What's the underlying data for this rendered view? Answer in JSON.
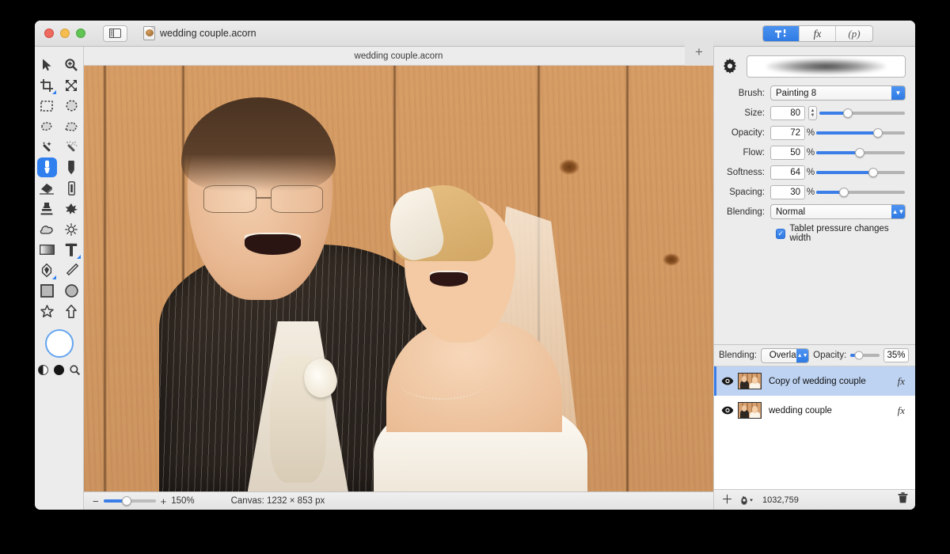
{
  "window": {
    "traffic_lights": [
      "close",
      "minimize",
      "zoom"
    ],
    "sidebar_toggle_icon": "sidebar-icon",
    "document_title": "wedding couple.acorn",
    "document_icon": "acorn-document-icon"
  },
  "titlebar_segments": [
    {
      "name": "tools-segment",
      "icon": "hammer-tool-icon",
      "label": "",
      "active": true
    },
    {
      "name": "filters-segment",
      "icon": "fx-icon",
      "label": "fx",
      "active": false
    },
    {
      "name": "palette-segment",
      "icon": "p-icon",
      "label": "(p)",
      "active": false
    }
  ],
  "tools": [
    {
      "name": "move-tool",
      "icon": "arrow-cursor-icon",
      "selected": false,
      "submenu": false
    },
    {
      "name": "zoom-tool",
      "icon": "magnifier-plus-icon",
      "selected": false,
      "submenu": false
    },
    {
      "name": "crop-tool",
      "icon": "crop-icon",
      "selected": false,
      "submenu": true
    },
    {
      "name": "transform-tool",
      "icon": "move-arrows-icon",
      "selected": false,
      "submenu": false
    },
    {
      "name": "rectangular-select-tool",
      "icon": "marquee-rect-icon",
      "selected": false,
      "submenu": false
    },
    {
      "name": "elliptical-select-tool",
      "icon": "marquee-ellipse-icon",
      "selected": false,
      "submenu": false
    },
    {
      "name": "lasso-tool",
      "icon": "lasso-icon",
      "selected": false,
      "submenu": false
    },
    {
      "name": "polygon-lasso-tool",
      "icon": "polygon-lasso-icon",
      "selected": false,
      "submenu": false
    },
    {
      "name": "magic-wand-tool",
      "icon": "magic-wand-icon",
      "selected": false,
      "submenu": false
    },
    {
      "name": "instant-alpha-tool",
      "icon": "sparkle-wand-icon",
      "selected": false,
      "submenu": false
    },
    {
      "name": "brush-tool",
      "icon": "paint-brush-icon",
      "selected": true,
      "submenu": false
    },
    {
      "name": "pencil-tool",
      "icon": "pencil-icon",
      "selected": false,
      "submenu": false
    },
    {
      "name": "eraser-tool",
      "icon": "eraser-icon",
      "selected": false,
      "submenu": false
    },
    {
      "name": "smudge-tool",
      "icon": "smudge-icon",
      "selected": false,
      "submenu": false
    },
    {
      "name": "clone-stamp-tool",
      "icon": "clone-stamp-icon",
      "selected": false,
      "submenu": false
    },
    {
      "name": "spatter-tool",
      "icon": "spatter-icon",
      "selected": false,
      "submenu": false
    },
    {
      "name": "blur-tool",
      "icon": "cloud-blur-icon",
      "selected": false,
      "submenu": false
    },
    {
      "name": "dodge-burn-tool",
      "icon": "sun-dodge-icon",
      "selected": false,
      "submenu": false
    },
    {
      "name": "gradient-tool",
      "icon": "gradient-icon",
      "selected": false,
      "submenu": false
    },
    {
      "name": "text-tool",
      "icon": "text-t-icon",
      "selected": false,
      "submenu": true
    },
    {
      "name": "bezier-pen-tool",
      "icon": "pen-nib-icon",
      "selected": false,
      "submenu": true
    },
    {
      "name": "line-tool",
      "icon": "line-icon",
      "selected": false,
      "submenu": false
    },
    {
      "name": "rectangle-shape-tool",
      "icon": "rectangle-icon",
      "selected": false,
      "submenu": false
    },
    {
      "name": "ellipse-shape-tool",
      "icon": "circle-icon",
      "selected": false,
      "submenu": false
    },
    {
      "name": "star-shape-tool",
      "icon": "star-icon",
      "selected": false,
      "submenu": false
    },
    {
      "name": "arrow-shape-tool",
      "icon": "arrow-up-shape-icon",
      "selected": false,
      "submenu": false
    }
  ],
  "color_controls": {
    "foreground_swatch": "#ffffff",
    "half_swatch_icon": "contrast-half-icon",
    "black_swatch_icon": "black-dot-icon",
    "color_picker_icon": "magnifier-picker-icon"
  },
  "canvas": {
    "tab_title": "wedding couple.acorn",
    "add_tab_label": "+",
    "image_description": "wedding couple in front of wooden fence"
  },
  "statusbar": {
    "zoom_minus": "−",
    "zoom_plus": "+",
    "zoom_level": "150%",
    "canvas_size": "Canvas: 1232 × 853 px"
  },
  "inspector": {
    "gear_icon": "gear-icon",
    "brush_preview": "soft-round-brush-stroke-preview",
    "rows": [
      {
        "label": "Brush:",
        "type": "combo",
        "value": "Painting 8",
        "unit": ""
      },
      {
        "label": "Size:",
        "type": "stepper",
        "value": "80",
        "unit": "",
        "slider_pct": 33
      },
      {
        "label": "Opacity:",
        "type": "slider",
        "value": "72",
        "unit": "%",
        "slider_pct": 70
      },
      {
        "label": "Flow:",
        "type": "slider",
        "value": "50",
        "unit": "%",
        "slider_pct": 49
      },
      {
        "label": "Softness:",
        "type": "slider",
        "value": "64",
        "unit": "%",
        "slider_pct": 64
      },
      {
        "label": "Spacing:",
        "type": "slider",
        "value": "30",
        "unit": "%",
        "slider_pct": 31
      },
      {
        "label": "Blending:",
        "type": "popup",
        "value": "Normal",
        "unit": ""
      }
    ],
    "checkbox": {
      "label": "Tablet pressure changes width",
      "checked": true
    }
  },
  "layers_panel": {
    "blending_label": "Blending:",
    "blending_value": "Overlay",
    "opacity_label": "Opacity:",
    "opacity_value": "35%",
    "opacity_pct": 30,
    "rows": [
      {
        "name": "Copy of wedding couple",
        "visible": true,
        "fx": "fx",
        "selected": true
      },
      {
        "name": "wedding couple",
        "visible": true,
        "fx": "fx",
        "selected": false
      }
    ],
    "footer": {
      "add_icon": "plus-icon",
      "settings_icon": "gear-dropdown-icon",
      "coordinates": "1032,759",
      "delete_icon": "trash-icon"
    }
  },
  "colors": {
    "accent_blue": "#2f7fef",
    "selection_blue": "#bed3f2",
    "chrome_gray": "#ececec"
  }
}
